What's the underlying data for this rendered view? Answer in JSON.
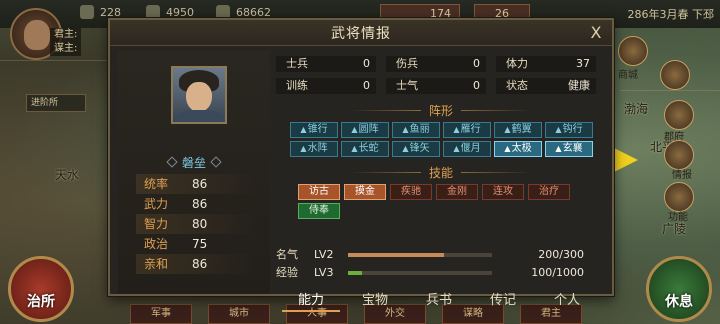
{
  "top": {
    "res1": "228",
    "res2": "4950",
    "res3": "68662",
    "res4": "174",
    "res5": "26",
    "date": "286年3月春 下邳"
  },
  "lord": {
    "row1": "君主:",
    "row2": "谋主:",
    "level": "1"
  },
  "promotion_label": "进阶所",
  "map": {
    "tianshui": "天水",
    "bo_hai": "渤海",
    "bei_ping": "北平",
    "guang_ling": "广陵",
    "shang_cheng": "商城",
    "xiangqing": "情报",
    "gongneng": "功能",
    "jun_fu": "郡府"
  },
  "side_buttons": {
    "left": "治所",
    "right": "休息"
  },
  "bottom_tabs": [
    "军事",
    "城市",
    "人事",
    "外交",
    "谋略",
    "君主"
  ],
  "dialog": {
    "title": "武将情报",
    "close": "X",
    "general_name": "磐垒",
    "stats": [
      {
        "k": "统率",
        "v": "86"
      },
      {
        "k": "武力",
        "v": "86"
      },
      {
        "k": "智力",
        "v": "80"
      },
      {
        "k": "政治",
        "v": "75"
      },
      {
        "k": "亲和",
        "v": "86"
      }
    ],
    "vitals": [
      {
        "k": "士兵",
        "v": "0"
      },
      {
        "k": "伤兵",
        "v": "0"
      },
      {
        "k": "体力",
        "v": "37"
      },
      {
        "k": "训练",
        "v": "0"
      },
      {
        "k": "士气",
        "v": "0"
      },
      {
        "k": "状态",
        "v": "健康"
      }
    ],
    "formation_title": "阵形",
    "formations": [
      {
        "label": "锥行",
        "active": false
      },
      {
        "label": "圆阵",
        "active": false
      },
      {
        "label": "鱼丽",
        "active": false
      },
      {
        "label": "雁行",
        "active": false
      },
      {
        "label": "鹤翼",
        "active": false
      },
      {
        "label": "钩行",
        "active": false
      },
      {
        "label": "水阵",
        "active": false
      },
      {
        "label": "长蛇",
        "active": false
      },
      {
        "label": "锋矢",
        "active": false
      },
      {
        "label": "偃月",
        "active": false
      },
      {
        "label": "太极",
        "active": true
      },
      {
        "label": "玄襄",
        "active": true
      }
    ],
    "skill_title": "技能",
    "skills": [
      {
        "label": "访古",
        "state": "active"
      },
      {
        "label": "摸金",
        "state": "active"
      },
      {
        "label": "疾驰",
        "state": "normal"
      },
      {
        "label": "金刚",
        "state": "normal"
      },
      {
        "label": "连攻",
        "state": "normal"
      },
      {
        "label": "治疗",
        "state": "normal"
      },
      {
        "label": "侍奉",
        "state": "green"
      }
    ],
    "fame": {
      "k": "名气",
      "lv": "LV2",
      "v": "200/300",
      "ratio": 0.6667,
      "color": "#c88a58"
    },
    "exp": {
      "k": "经验",
      "lv": "LV3",
      "v": "100/1000",
      "ratio": 0.1,
      "color": "#6ab03a"
    },
    "tabs": [
      {
        "label": "能力",
        "active": true
      },
      {
        "label": "宝物",
        "active": false
      },
      {
        "label": "兵书",
        "active": false
      },
      {
        "label": "传记",
        "active": false
      },
      {
        "label": "个人",
        "active": false
      }
    ]
  }
}
